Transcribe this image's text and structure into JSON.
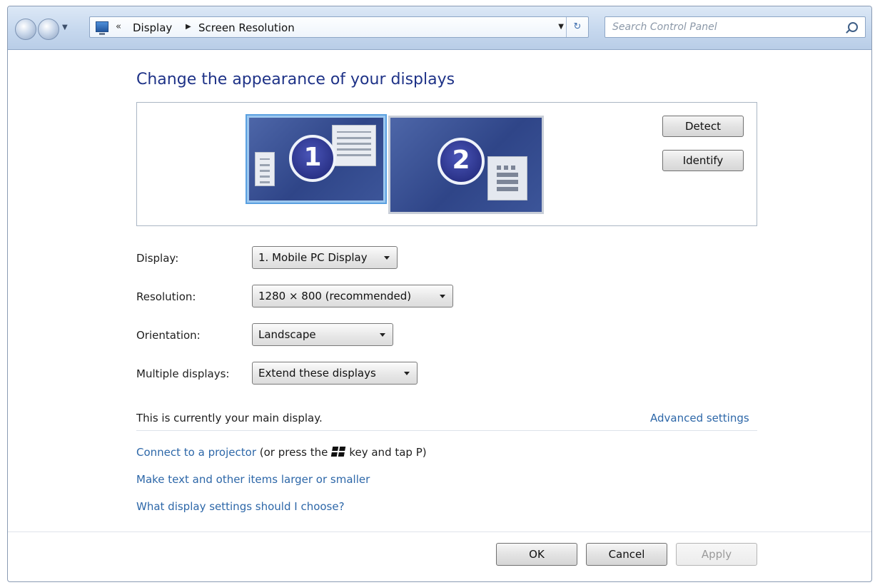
{
  "navigation": {
    "breadcrumb": [
      "Display",
      "Screen Resolution"
    ],
    "overflow_chevron": "«",
    "refresh_glyph": "↻",
    "search_placeholder": "Search Control Panel"
  },
  "page": {
    "title": "Change the appearance of your displays"
  },
  "preview": {
    "monitors": [
      {
        "number": "1",
        "selected": true
      },
      {
        "number": "2",
        "selected": false
      }
    ],
    "detect_label": "Detect",
    "identify_label": "Identify"
  },
  "form": {
    "display": {
      "label": "Display:",
      "value": "1. Mobile PC Display"
    },
    "resolution": {
      "label": "Resolution:",
      "value": "1280 × 800 (recommended)"
    },
    "orientation": {
      "label": "Orientation:",
      "value": "Landscape"
    },
    "multiple_displays": {
      "label": "Multiple displays:",
      "value": "Extend these displays"
    }
  },
  "status": {
    "main_display_text": "This is currently your main display.",
    "advanced_settings_link": "Advanced settings"
  },
  "links": {
    "connect_projector": "Connect to a projector",
    "projector_hint_before": "(or press the",
    "projector_hint_after": "key and tap P)",
    "text_size": "Make text and other items larger or smaller",
    "display_help": "What display settings should I choose?"
  },
  "footer": {
    "ok_label": "OK",
    "cancel_label": "Cancel",
    "apply_label": "Apply",
    "apply_enabled": false
  },
  "colors": {
    "title": "#1e3287",
    "link": "#2d67a8",
    "selected_monitor_border": "#9cc7ef"
  }
}
